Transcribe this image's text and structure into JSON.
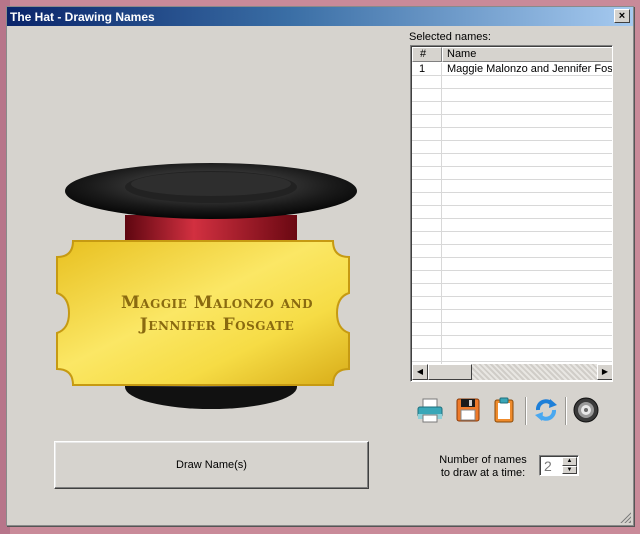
{
  "window": {
    "title": "The Hat - Drawing Names",
    "close_glyph": "×"
  },
  "selected": {
    "label": "Selected names:",
    "columns": [
      "#",
      "Name"
    ],
    "rows": [
      {
        "num": "1",
        "name": "Maggie Malonzo and Jennifer Fosgate"
      }
    ]
  },
  "ticket": {
    "line1": "Maggie Malonzo and",
    "line2": "Jennifer Fosgate"
  },
  "toolbar": {
    "icons": [
      "printer-icon",
      "floppy-disk-icon",
      "clipboard-icon",
      "refresh-icon",
      "speaker-icon"
    ]
  },
  "draw": {
    "button_label": "Draw Name(s)"
  },
  "count": {
    "label_line1": "Number of names",
    "label_line2": "to draw at a time:",
    "value": "2"
  },
  "colors": {
    "titlebar_start": "#0a246a",
    "titlebar_end": "#a6caf0",
    "window_face": "#d6d3ce",
    "ticket_gold": "#f2d43a",
    "hat_band": "#b01020"
  }
}
